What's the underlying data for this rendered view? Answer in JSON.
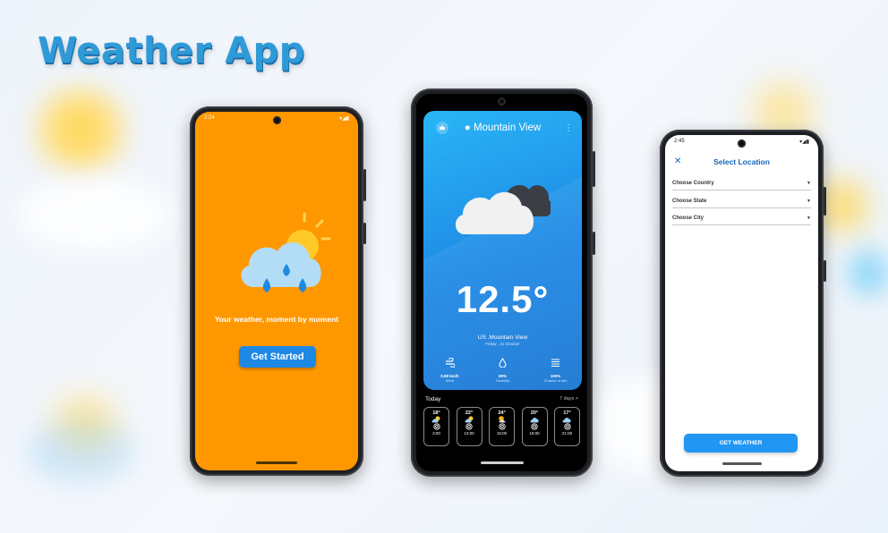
{
  "page": {
    "title": "Weather App"
  },
  "colors": {
    "title": "#2f9ad8",
    "splash_bg": "#ff9800",
    "accent_blue": "#1e88e5",
    "select_title": "#1565c0"
  },
  "splash": {
    "status_time": "2:24",
    "tagline": "Your weather, moment by moment",
    "start_button": "Get Started",
    "illustration": "cloud-sun-rain-icon"
  },
  "current": {
    "location": "Mountain View",
    "temperature": "12.5°",
    "city_line": "US ,Mountain View",
    "date_line": "Friday , 31 October",
    "illustration": "cloud-icon",
    "stats": [
      {
        "icon": "wind-icon",
        "value": "0.89 km/h",
        "label": "Wind"
      },
      {
        "icon": "humidity-icon",
        "value": "89%",
        "label": "Humidity"
      },
      {
        "icon": "chance-icon",
        "value": "100%",
        "label": "Chance of rain"
      }
    ],
    "today_label": "Today",
    "days_link": "7 days >",
    "hourly": [
      {
        "temp": "18°",
        "time": "3:00"
      },
      {
        "temp": "22°",
        "time": "12:00"
      },
      {
        "temp": "24°",
        "time": "15:00"
      },
      {
        "temp": "20°",
        "time": "18:00"
      },
      {
        "temp": "17°",
        "time": "21:00"
      }
    ]
  },
  "select_location": {
    "status_time": "2:45",
    "title": "Select Location",
    "fields": [
      {
        "label": "Choose Country"
      },
      {
        "label": "Choose State"
      },
      {
        "label": "Choose City"
      }
    ],
    "submit_button": "GET WEATHER"
  }
}
